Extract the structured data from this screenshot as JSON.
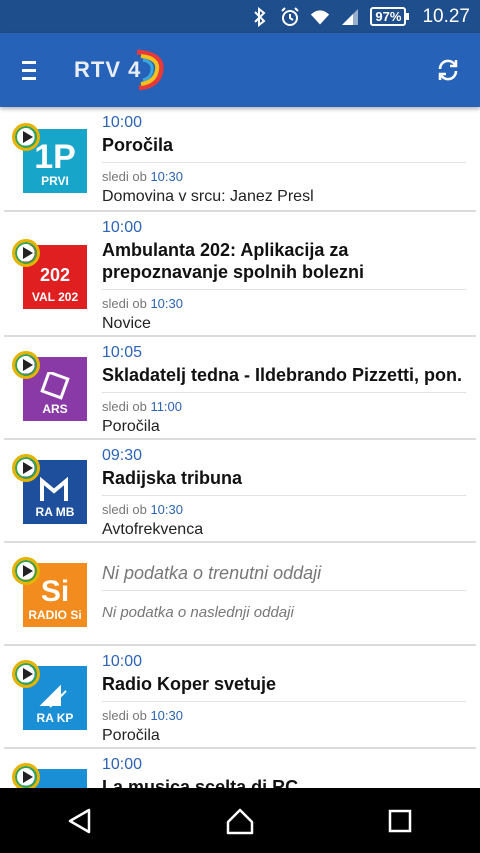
{
  "status_bar": {
    "battery": "97%",
    "time": "10.27",
    "icons": [
      "bluetooth-icon",
      "alarm-icon",
      "wifi-icon",
      "signal-icon"
    ]
  },
  "app_bar": {
    "logo_text": "RTV 4",
    "menu_icon": "menu-icon",
    "refresh_icon": "refresh-icon",
    "primary_color": "#2662b8"
  },
  "stations": [
    {
      "logo_label": "PRVI",
      "logo_mark": "1P",
      "logo_color": "#17a6c9",
      "time": "10:00",
      "title": "Poročila",
      "next_label": "sledi ob",
      "next_time": "10:30",
      "next_title": "Domovina v srcu: Janez Presl"
    },
    {
      "logo_label": "VAL 202",
      "logo_mark": "202",
      "logo_color": "#e02020",
      "time": "10:00",
      "title": "Ambulanta 202: Aplikacija za prepoznavanje spolnih bolezni",
      "next_label": "sledi ob",
      "next_time": "10:30",
      "next_title": "Novice"
    },
    {
      "logo_label": "ARS",
      "logo_mark": "ars",
      "logo_color": "#8a3aa6",
      "time": "10:05",
      "title": "Skladatelj tedna - Ildebrando Pizzetti, pon.",
      "next_label": "sledi ob",
      "next_time": "11:00",
      "next_title": "Poročila"
    },
    {
      "logo_label": "RA MB",
      "logo_mark": "mb",
      "logo_color": "#1d4f9c",
      "time": "09:30",
      "title": "Radijska tribuna",
      "next_label": "sledi ob",
      "next_time": "10:30",
      "next_title": "Avtofrekvenca"
    },
    {
      "logo_label": "RADIO Si",
      "logo_mark": "Si",
      "logo_color": "#f28c1e",
      "time": "",
      "title": "Ni podatka o trenutni oddaji",
      "next_label": "Ni podatka o naslednji oddaji",
      "next_time": "",
      "next_title": ""
    },
    {
      "logo_label": "RA KP",
      "logo_mark": "kp",
      "logo_color": "#1a8fd6",
      "time": "10:00",
      "title": "Radio Koper svetuje",
      "next_label": "sledi ob",
      "next_time": "10:30",
      "next_title": "Poročila"
    },
    {
      "logo_label": "",
      "logo_mark": "",
      "logo_color": "#1a8fd6",
      "time": "10:00",
      "title": "La musica scelta di RC",
      "next_label": "",
      "next_time": "",
      "next_title": ""
    }
  ],
  "nav_bar": {
    "back_icon": "back-icon",
    "home_icon": "home-icon",
    "recents_icon": "recents-icon"
  }
}
